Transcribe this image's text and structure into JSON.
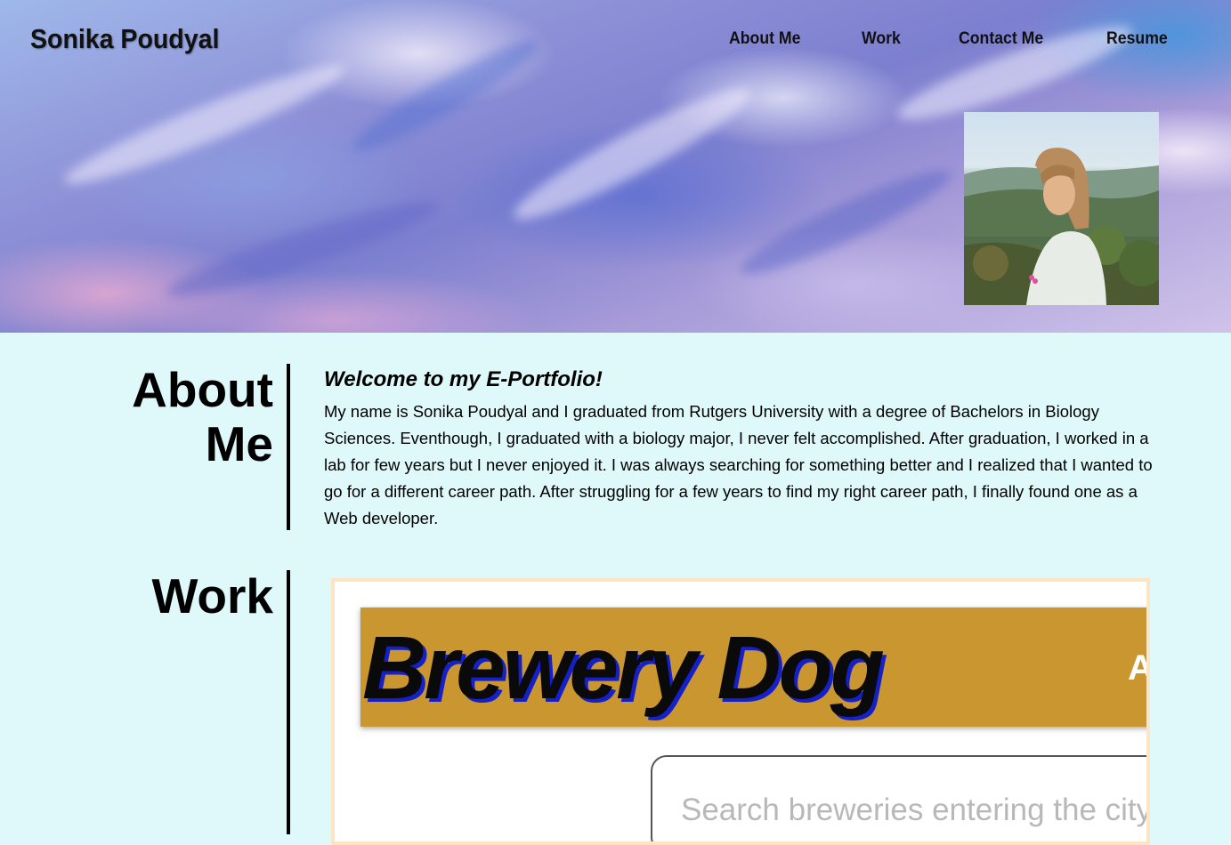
{
  "header": {
    "site_title": "Sonika Poudyal",
    "nav": [
      "About Me",
      "Work",
      "Contact Me",
      "Resume"
    ]
  },
  "about": {
    "heading_line1": "About",
    "heading_line2": "Me",
    "welcome": "Welcome to my E-Portfolio!",
    "text": "My name is Sonika Poudyal and I graduated from Rutgers University with a degree of Bachelors in Biology Sciences. Eventhough, I graduated with a biology major, I never felt accomplished. After graduation, I worked in a lab for few years but I never enjoyed it. I was always searching for something better and I realized that I wanted to go for a different career path. After struggling for a few years to find my right career path, I finally found one as a Web developer."
  },
  "work": {
    "heading": "Work",
    "project": {
      "title": "Brewery Dog",
      "nav_partial": "A",
      "search_placeholder": "Search breweries entering the city"
    }
  },
  "colors": {
    "page_background": "#dff8fa",
    "banner": "#c9962f",
    "frame_border": "#fde4c3"
  }
}
